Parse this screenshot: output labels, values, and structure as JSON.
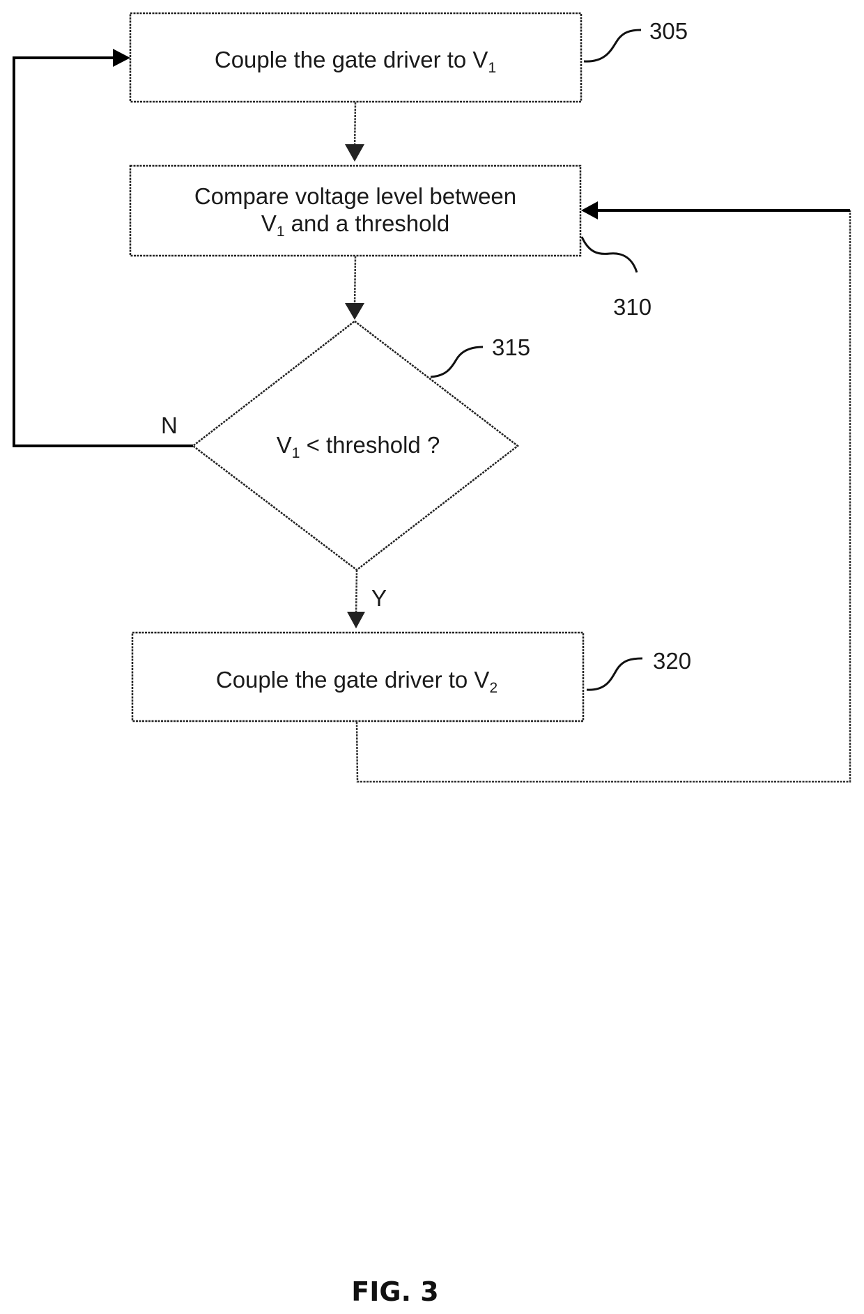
{
  "figure": {
    "caption": "FIG. 3",
    "steps": [
      {
        "id": "305",
        "ref": "305",
        "kind": "process",
        "text": "Couple the gate driver to V",
        "sub": "1"
      },
      {
        "id": "310",
        "ref": "310",
        "kind": "process",
        "line1": "Compare voltage level between",
        "line2_prefix": "V",
        "line2_sub": "1",
        "line2_suffix": " and a threshold"
      },
      {
        "id": "315",
        "ref": "315",
        "kind": "decision",
        "prefix": "V",
        "sub": "1",
        "suffix": " < threshold ?"
      },
      {
        "id": "320",
        "ref": "320",
        "kind": "process",
        "text": "Couple the gate driver to  V",
        "sub": "2"
      }
    ],
    "branches": {
      "no_label": "N",
      "yes_label": "Y"
    },
    "connections": [
      {
        "from": "305",
        "to": "310"
      },
      {
        "from": "310",
        "to": "315"
      },
      {
        "from": "315",
        "to": "320",
        "label": "Y"
      },
      {
        "from": "315",
        "to": "305",
        "label": "N"
      },
      {
        "from": "320",
        "to": "310"
      }
    ]
  }
}
